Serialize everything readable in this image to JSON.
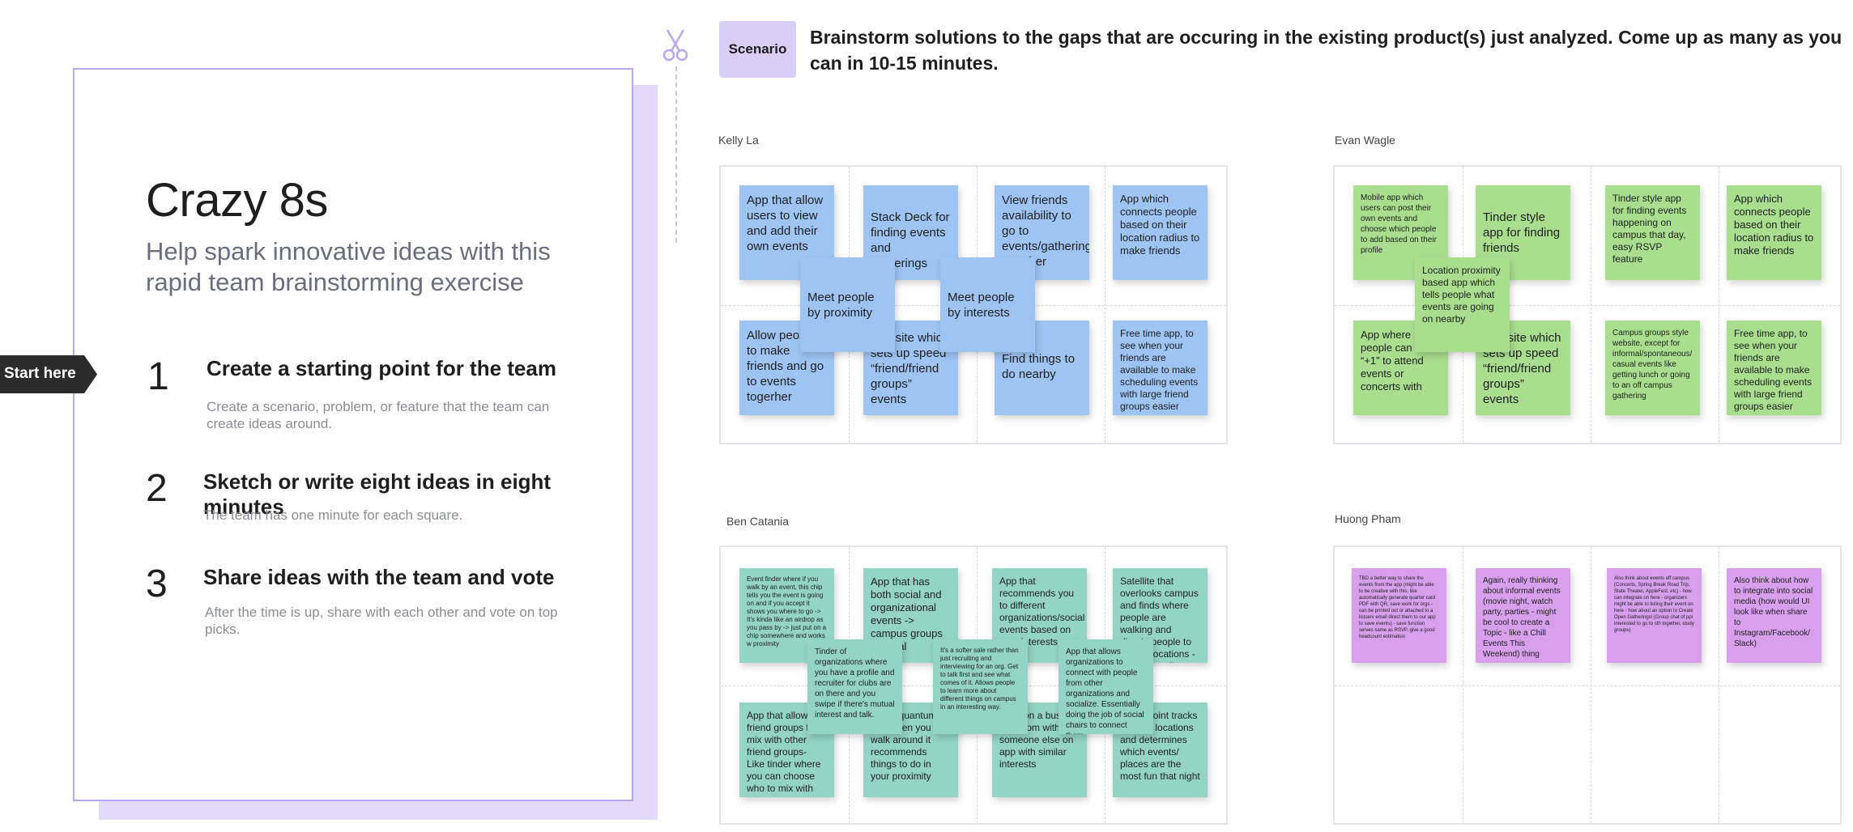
{
  "intro": {
    "title": "Crazy 8s",
    "subtitle": "Help spark innovative ideas with this rapid team brainstorming exercise",
    "start_label": "Start here",
    "steps": [
      {
        "num": "1",
        "title": "Create a starting point for the team",
        "desc": "Create a scenario, problem, or feature that the team can create ideas around."
      },
      {
        "num": "2",
        "title": "Sketch or write eight ideas in eight minutes",
        "desc": "The team has one minute for each square."
      },
      {
        "num": "3",
        "title": "Share ideas with the team and vote",
        "desc": "After the time is up, share with each other and vote on top picks."
      }
    ]
  },
  "scenario": {
    "label": "Scenario",
    "text": "Brainstorm solutions to the gaps that are occuring in the existing product(s) just analyzed. Come up as many as you can in 10-15 minutes."
  },
  "colors": {
    "blue": "#9ec4f4",
    "green": "#a9de8e",
    "teal": "#93d4c6",
    "purple": "#d8a0ec",
    "accent": "#b9a5f0"
  },
  "boards": [
    {
      "name": "Kelly La",
      "notes": [
        "App that allow users to view and add their own events",
        "Stack Deck for finding events and gatherings",
        "View friends availability to go to events/gatherings together",
        "App which connects people based on their location radius to make friends",
        "Allow people to make friends and go to events togerher",
        "Website which sets up speed “friend/friend groups” events",
        "Find things to do nearby",
        "Free time app, to see when your friends are available to make scheduling events with large friend groups easier",
        "Meet people by proximity",
        "Meet people by interests"
      ]
    },
    {
      "name": "Evan Wagle",
      "notes": [
        "Mobile app which users can post their own events and choose which people to add based on their profile",
        "Tinder style app for finding friends",
        "Tinder style app for finding events happening on campus that day, easy RSVP feature",
        "App which connects people based on their location radius to make friends",
        "App where people can be a “+1” to attend events or concerts with",
        "Website which sets up speed “friend/friend groups” events",
        "Campus groups style website, except for informal/spontaneous/ casual events like getting lunch or going to an off campus gathering",
        "Free time app, to see when your friends are available to make scheduling events with large friend groups easier",
        "Location proximity based app which tells people what events are going on nearby"
      ]
    },
    {
      "name": "Ben Catania",
      "notes": [
        "Event finder where if you walk by an event, this chip tells you the event is going on and if you accept it shows you where to go -> It's kinda like an airdrop as you pass by -> just put on a chip somewhere and works w proximity",
        "App that has both social and organizational events -> campus groups + social",
        "App that recommends you to different organizations/social events based on your interests, with AI",
        "Satellite that overlooks campus and finds where people are walking and directs people to similar locations -> safeguarding",
        "App that allows friend groups to mix with other friend groups- Like tinder where you can choose who to mix with",
        "Music quantum that when you walk around it recommends things to do in your proximity",
        "Meet on a bus or in a room with someone else on app with similar interests",
        "Checkpoint tracks popular locations and determines which events/ places are the most fun that night",
        "Tinder of organizations where you have a profile and recruiter for clubs are on there and you swipe if there's mutual interest and talk.",
        "It's a softer sale rather than just recruiting and interviewing for an org. Get to talk first and see what comes of it. Allows people to learn more about different things on campus in an interesting way.",
        "App that allows organizations to connect with people from other organizations and socialize. Essentially doing the job of social chairs to connect them."
      ]
    },
    {
      "name": "Huong Pham",
      "notes": [
        "TBD a better way to share the events from the app (might be able to be creative with this, like automatically generate quarter card PDF with QR, save work for orgs - can be printed out or attached to a listserv email direct them to our app to save events) - save function serves same as RSVP, give a good headcount estimation",
        "Again, really thinking about informal events (movie night, watch party, parties - might be cool to create a Topic - like a Chill Events This Weekend) thing",
        "Also think about events off campus (Concerts, Spring Break Road Trip, State Theater, AppleFest, etc) - how can integrate on here - organizers might be able to listing their event on here - how about an option to Create Open Gatherings! (Group chat of ppl interested to go to sth together, study groups)",
        "Also think about how to integrate into social media (how would UI look like when share to Instagram/Facebook/ Slack)"
      ]
    }
  ]
}
